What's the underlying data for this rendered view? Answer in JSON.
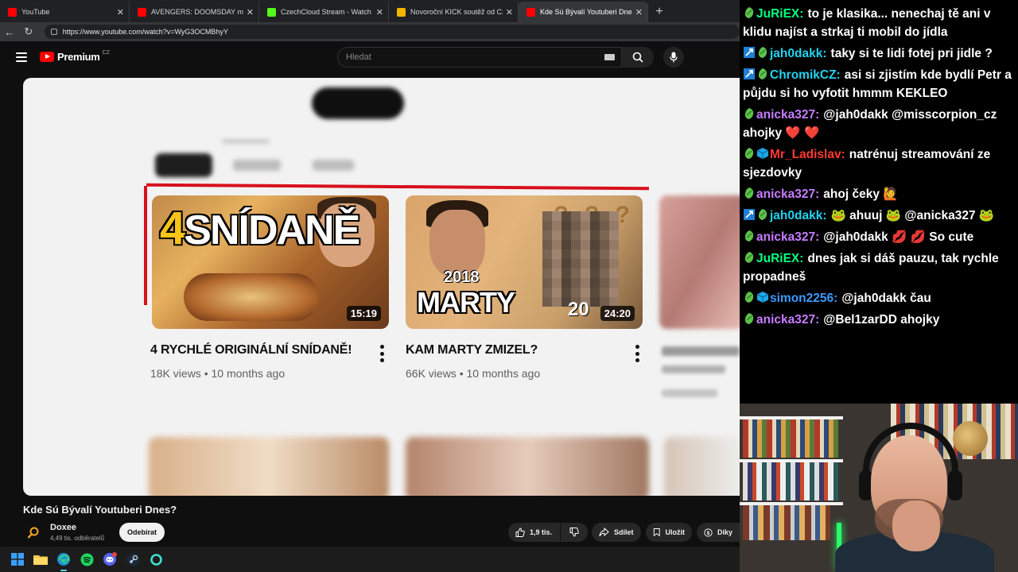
{
  "browser": {
    "tabs": [
      {
        "label": "YouTube",
        "fav_color": "#ff0000",
        "active": false
      },
      {
        "label": "AVENGERS: DOOMSDAY mě začín…",
        "fav_color": "#ff0000",
        "active": false
      },
      {
        "label": "CzechCloud Stream - Watch Live o…",
        "fav_color": "#53fc18",
        "active": false
      },
      {
        "label": "Novoroční KICK soutěž od CzechC…",
        "fav_color": "#f4b400",
        "active": false
      },
      {
        "label": "Kde Sú Bývalí Youtuberi Dnes? - Yo…",
        "fav_color": "#ff0000",
        "active": true
      }
    ],
    "new_tab": "+",
    "url": "https://www.youtube.com/watch?v=WyG3OCMBhyY"
  },
  "youtube": {
    "brand": "Premium",
    "region": "CZ",
    "search_placeholder": "Hledat"
  },
  "player": {
    "videos": [
      {
        "title": "4 RYCHLÉ ORIGINÁLNÍ SNÍDANĚ!",
        "views": "18K views",
        "age": "10 months ago",
        "duration": "15:19",
        "thumb_num": "4",
        "thumb_text": "SNÍDANĚ"
      },
      {
        "title": "KAM MARTY ZMIZEL?",
        "views": "66K views",
        "age": "10 months ago",
        "duration": "24:20",
        "thumb_year": "2018",
        "thumb_text": "MARTY",
        "thumb_year2": "20",
        "thumb_marks": "? ? ?"
      }
    ],
    "meta_sep": "•"
  },
  "video_info": {
    "title": "Kde Sú Bývalí Youtuberi Dnes?",
    "channel": "Doxee",
    "subscribers": "4,49 tis. odběratelů",
    "subscribe_label": "Odebírat",
    "like_count": "1,9 tis.",
    "share_label": "Sdílet",
    "save_label": "Uložit",
    "thanks_label": "Díky"
  },
  "chat": {
    "messages": [
      {
        "user": "JuRiEX",
        "color": "#00ff7f",
        "badges": [
          "green"
        ],
        "text": "to je klasika... nenechaj tě ani v klidu najíst a strkaj ti mobil do jídla"
      },
      {
        "user": "jah0dakk",
        "color": "#22d3ee",
        "badges": [
          "blue",
          "green"
        ],
        "text": "taky si te lidi fotej pri jidle ?"
      },
      {
        "user": "ChromikCZ",
        "color": "#22d3ee",
        "badges": [
          "blue",
          "green"
        ],
        "text": "asi si zjistím kde bydlí Petr a půjdu si ho vyfotit hmmm KEKLEO"
      },
      {
        "user": "anicka327",
        "color": "#c77dff",
        "badges": [
          "green"
        ],
        "text": "@jah0dakk @misscorpion_cz ahojky ❤️ ❤️"
      },
      {
        "user": "Mr_Ladislav",
        "color": "#ff3b30",
        "badges": [
          "green",
          "cube"
        ],
        "text": "natrénuj streamování ze sjezdovky"
      },
      {
        "user": "anicka327",
        "color": "#c77dff",
        "badges": [
          "green"
        ],
        "text": "ahoj čeky 🙋"
      },
      {
        "user": "jah0dakk",
        "color": "#22d3ee",
        "badges": [
          "blue",
          "green"
        ],
        "text": "🐸 ahuuj 🐸 @anicka327 🐸"
      },
      {
        "user": "anicka327",
        "color": "#c77dff",
        "badges": [
          "green"
        ],
        "text": "@jah0dakk 💋 💋 So cute"
      },
      {
        "user": "JuRiEX",
        "color": "#00ff7f",
        "badges": [
          "green"
        ],
        "text": "dnes jak si dáš pauzu, tak rychle propadneš"
      },
      {
        "user": "simon2256",
        "color": "#3b9bff",
        "badges": [
          "green",
          "cube"
        ],
        "text": "@jah0dakk čau"
      },
      {
        "user": "anicka327",
        "color": "#c77dff",
        "badges": [
          "green"
        ],
        "text": "@Bel1zarDD ahojky"
      }
    ],
    "separator": ":"
  }
}
